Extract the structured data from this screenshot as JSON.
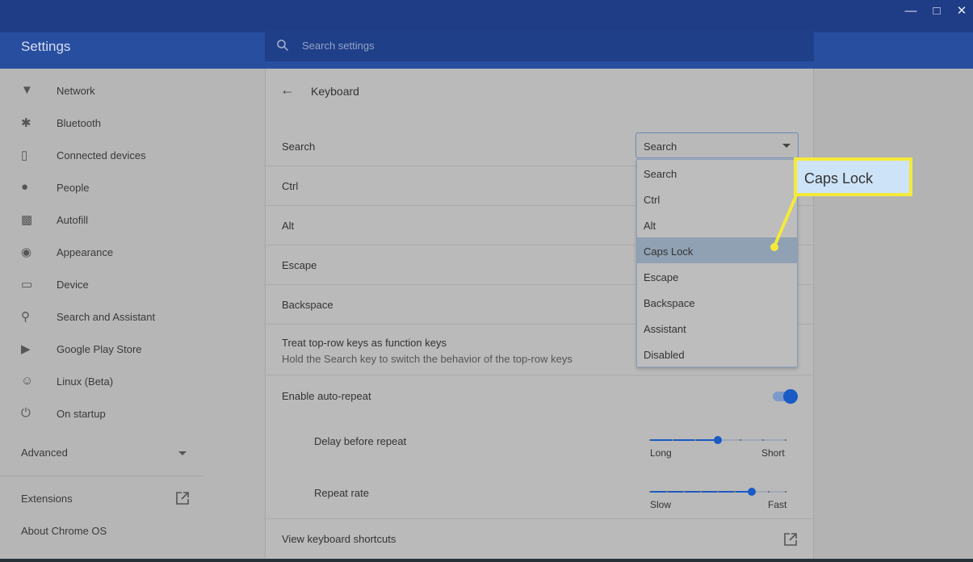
{
  "window": {
    "controls": [
      "minimize-icon",
      "maximize-icon",
      "close-icon"
    ]
  },
  "header": {
    "title": "Settings",
    "search_placeholder": "Search settings"
  },
  "sidebar": {
    "items": [
      {
        "label": "Network",
        "icon": "wifi-icon"
      },
      {
        "label": "Bluetooth",
        "icon": "bluetooth-icon"
      },
      {
        "label": "Connected devices",
        "icon": "phone-icon"
      },
      {
        "label": "People",
        "icon": "person-icon"
      },
      {
        "label": "Autofill",
        "icon": "clipboard-icon"
      },
      {
        "label": "Appearance",
        "icon": "palette-icon"
      },
      {
        "label": "Device",
        "icon": "laptop-icon"
      },
      {
        "label": "Search and Assistant",
        "icon": "search-icon"
      },
      {
        "label": "Google Play Store",
        "icon": "play-store-icon"
      },
      {
        "label": "Linux (Beta)",
        "icon": "penguin-icon"
      },
      {
        "label": "On startup",
        "icon": "power-icon"
      }
    ],
    "advanced": "Advanced",
    "extensions": "Extensions",
    "about": "About Chrome OS"
  },
  "page": {
    "title": "Keyboard",
    "keys": [
      "Search",
      "Ctrl",
      "Alt",
      "Escape",
      "Backspace"
    ],
    "dropdown": {
      "value": "Search",
      "options": [
        "Search",
        "Ctrl",
        "Alt",
        "Caps Lock",
        "Escape",
        "Backspace",
        "Assistant",
        "Disabled"
      ],
      "highlighted": "Caps Lock"
    },
    "top_row": {
      "label": "Treat top-row keys as function keys",
      "sub": "Hold the Search key to switch the behavior of the top-row keys"
    },
    "auto_repeat": {
      "label": "Enable auto-repeat",
      "on": true
    },
    "delay": {
      "label": "Delay before repeat",
      "min": "Long",
      "max": "Short",
      "value": 0.5,
      "steps": 7
    },
    "rate": {
      "label": "Repeat rate",
      "min": "Slow",
      "max": "Fast",
      "value": 0.75,
      "steps": 9
    },
    "shortcuts": "View keyboard shortcuts"
  },
  "callout": {
    "text": "Caps Lock",
    "color": "#f5ea3a"
  },
  "colors": {
    "accent": "#1a5bc4",
    "header": "#284ea0"
  }
}
